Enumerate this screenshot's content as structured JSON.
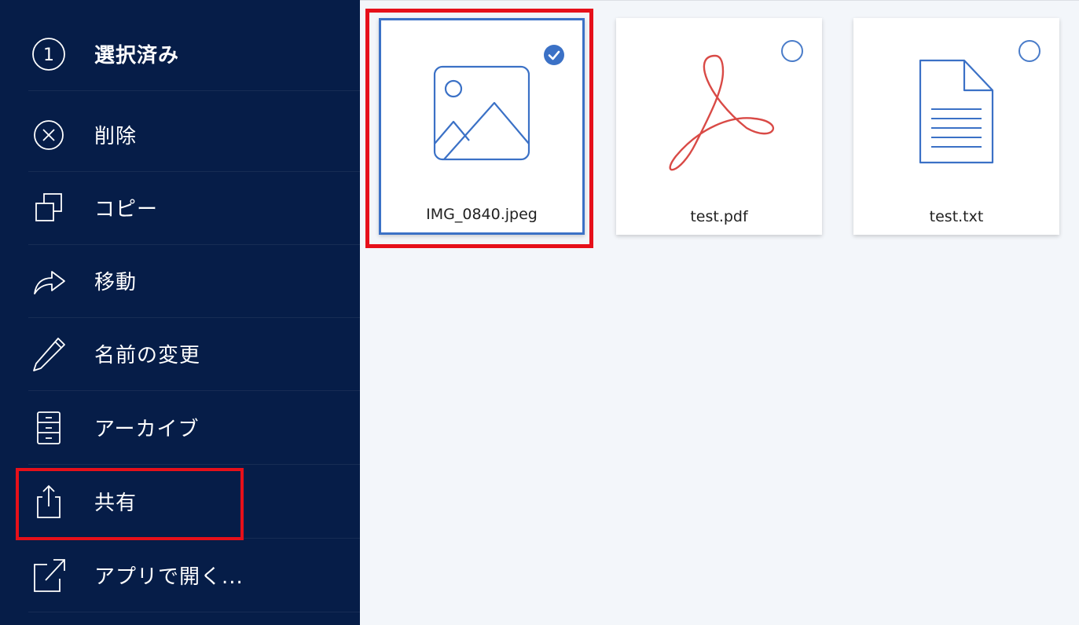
{
  "sidebar": {
    "items": [
      {
        "name": "selection-count",
        "icon": "count-circle-icon",
        "count": "1",
        "label": "選択済み"
      },
      {
        "name": "delete-button",
        "icon": "close-circle-icon",
        "label": "削除"
      },
      {
        "name": "copy-button",
        "icon": "copy-icon",
        "label": "コピー"
      },
      {
        "name": "move-button",
        "icon": "forward-arrow-icon",
        "label": "移動"
      },
      {
        "name": "rename-button",
        "icon": "pencil-icon",
        "label": "名前の変更"
      },
      {
        "name": "archive-button",
        "icon": "archive-icon",
        "label": "アーカイブ"
      },
      {
        "name": "share-button",
        "icon": "share-icon",
        "label": "共有"
      },
      {
        "name": "open-in-app-button",
        "icon": "external-link-icon",
        "label": "アプリで開く..."
      }
    ]
  },
  "files": [
    {
      "name": "IMG_0840.jpeg",
      "icon": "image-icon",
      "selected": true
    },
    {
      "name": "test.pdf",
      "icon": "pdf-icon",
      "selected": false
    },
    {
      "name": "test.txt",
      "icon": "text-document-icon",
      "selected": false
    }
  ],
  "colors": {
    "sidebar_bg": "#061d48",
    "content_bg": "#f3f6fa",
    "accent": "#3b71c6",
    "pdf_red": "#d94a46",
    "highlight_red": "#e6101a"
  }
}
